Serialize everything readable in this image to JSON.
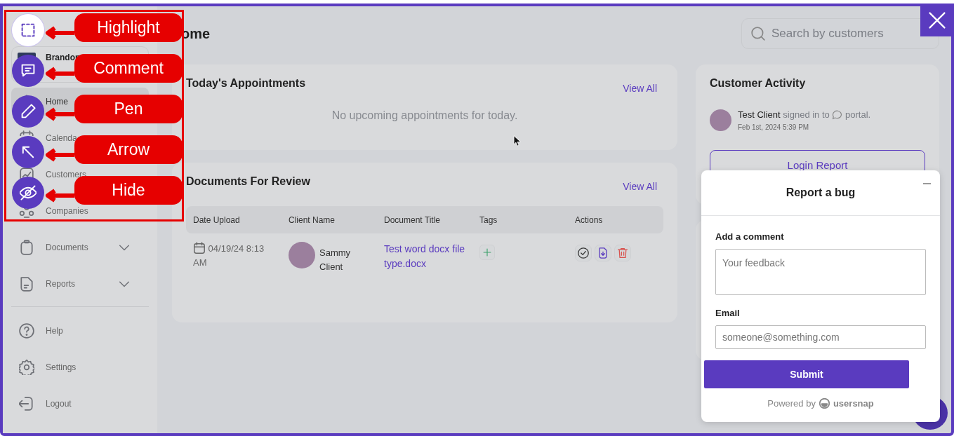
{
  "sidebar": {
    "user": {
      "name": "Brandon"
    },
    "items": [
      {
        "label": "Home",
        "kind": "link",
        "selected": true
      },
      {
        "label": "Calenda",
        "kind": "link",
        "selected": false
      },
      {
        "label": "Customers",
        "kind": "link",
        "selected": false
      },
      {
        "label": "Companies",
        "kind": "link",
        "selected": false
      },
      {
        "label": "Documents",
        "kind": "group",
        "selected": false,
        "expanded": false
      },
      {
        "label": "Reports",
        "kind": "group",
        "selected": false,
        "expanded": false
      }
    ],
    "footer_items": [
      {
        "label": "Help"
      },
      {
        "label": "Settings"
      },
      {
        "label": "Logout"
      }
    ]
  },
  "page": {
    "title": "ome"
  },
  "search": {
    "placeholder": "Search by customers"
  },
  "appointments": {
    "title": "Today's Appointments",
    "link": "View All",
    "empty": "No upcoming appointments for today."
  },
  "documents": {
    "title": "Documents For Review",
    "link": "View All",
    "columns": [
      "Date Upload",
      "Client Name",
      "Document Title",
      "Tags",
      "Actions"
    ],
    "rows": [
      {
        "date": "04/19/24 8:13 AM",
        "client": "Sammy Client",
        "document": "Test word docx file type.docx"
      }
    ]
  },
  "activity": {
    "title": "Customer Activity",
    "items": [
      {
        "actor": "Test Client",
        "action": "signed in to",
        "object": "portal.",
        "time": "Feb 1st, 2024 5:39 PM"
      }
    ],
    "button": "Login Report"
  },
  "bug_report": {
    "title": "Report a bug",
    "comment_label": "Add a comment",
    "comment_placeholder": "Your feedback",
    "email_label": "Email",
    "email_placeholder": "someone@something.com",
    "submit": "Submit",
    "powered_by": "Powered by",
    "brand": "usersnap"
  },
  "annotation_tools": [
    {
      "label": "Highlight",
      "selected": true
    },
    {
      "label": "Comment",
      "selected": false
    },
    {
      "label": "Pen",
      "selected": false
    },
    {
      "label": "Arrow",
      "selected": false
    },
    {
      "label": "Hide",
      "selected": false
    }
  ]
}
